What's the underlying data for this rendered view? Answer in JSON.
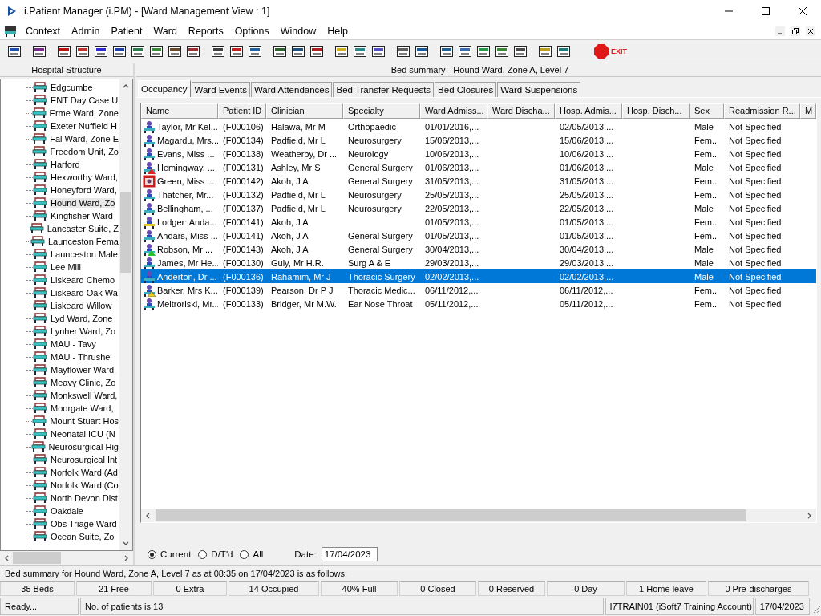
{
  "window": {
    "title": "i.Patient Manager (i.PM) - [Ward Management View : 1]"
  },
  "menu": [
    "Context",
    "Admin",
    "Patient",
    "Ward",
    "Reports",
    "Options",
    "Window",
    "Help"
  ],
  "toolbar": {
    "exit_label": "EXIT"
  },
  "sidebar": {
    "title": "Hospital Structure",
    "items": [
      {
        "label": "Edgcumbe",
        "selected": false
      },
      {
        "label": "ENT Day Case U",
        "selected": false
      },
      {
        "label": "Erme Ward, Zone",
        "selected": false
      },
      {
        "label": "Exeter Nuffield H",
        "selected": false
      },
      {
        "label": "Fal Ward, Zone E",
        "selected": false
      },
      {
        "label": "Freedom Unit, Zo",
        "selected": false
      },
      {
        "label": "Harford",
        "selected": false
      },
      {
        "label": "Hexworthy Ward,",
        "selected": false
      },
      {
        "label": "Honeyford Ward,",
        "selected": false
      },
      {
        "label": "Hound Ward, Zo",
        "selected": true
      },
      {
        "label": "Kingfisher Ward",
        "selected": false
      },
      {
        "label": "Lancaster Suite, Z",
        "selected": false
      },
      {
        "label": "Launceston Fema",
        "selected": false
      },
      {
        "label": "Launceston Male",
        "selected": false
      },
      {
        "label": "Lee Mill",
        "selected": false
      },
      {
        "label": "Liskeard Chemo",
        "selected": false
      },
      {
        "label": "Liskeard Oak Wa",
        "selected": false
      },
      {
        "label": "Liskeard Willow",
        "selected": false
      },
      {
        "label": "Lyd Ward, Zone",
        "selected": false
      },
      {
        "label": "Lynher Ward, Zo",
        "selected": false
      },
      {
        "label": "MAU - Tavy",
        "selected": false
      },
      {
        "label": "MAU - Thrushel",
        "selected": false
      },
      {
        "label": "Mayflower Ward,",
        "selected": false
      },
      {
        "label": "Meavy Clinic, Zo",
        "selected": false
      },
      {
        "label": "Monkswell Ward,",
        "selected": false
      },
      {
        "label": "Moorgate Ward,",
        "selected": false
      },
      {
        "label": "Mount Stuart Hos",
        "selected": false
      },
      {
        "label": "Neonatal ICU (N",
        "selected": false
      },
      {
        "label": "Neurosurgical Hig",
        "selected": false
      },
      {
        "label": "Neurosurgical Int",
        "selected": false
      },
      {
        "label": "Norfolk Ward (Ad",
        "selected": false
      },
      {
        "label": "Norfolk Ward (Co",
        "selected": false
      },
      {
        "label": "North Devon Dist",
        "selected": false
      },
      {
        "label": "Oakdale",
        "selected": false
      },
      {
        "label": "Obs Triage Ward",
        "selected": false
      },
      {
        "label": "Ocean Suite, Zo",
        "selected": false
      }
    ]
  },
  "panel_title": "Bed summary - Hound Ward, Zone A, Level 7",
  "tabs": [
    {
      "label": "Occupancy",
      "selected": true
    },
    {
      "label": "Ward Events",
      "selected": false
    },
    {
      "label": "Ward Attendances",
      "selected": false
    },
    {
      "label": "Bed Transfer Requests",
      "selected": false
    },
    {
      "label": "Bed Closures",
      "selected": false
    },
    {
      "label": "Ward Suspensions",
      "selected": false
    }
  ],
  "table": {
    "columns": [
      "Name",
      "Patient ID",
      "Clinician",
      "Specialty",
      "Ward Admiss...",
      "Ward Discha...",
      "Hosp. Admis...",
      "Hosp. Disch...",
      "Sex",
      "Readmission R...",
      "M"
    ],
    "rows": [
      {
        "kind": "patient",
        "selected": false,
        "name": "Taylor, Mr Kel...",
        "patient_id": "(F000106)",
        "clinician": "Halawa, Mr M",
        "specialty": "Orthopaedic",
        "ward_admission": "01/01/2016,...",
        "hosp_admission": "02/05/2013,...",
        "sex": "Male",
        "readmission": "Not Specified"
      },
      {
        "kind": "patient",
        "selected": false,
        "name": "Magardu, Mrs...",
        "patient_id": "(F000134)",
        "clinician": "Padfield, Mr L",
        "specialty": "Neurosurgery",
        "ward_admission": "15/06/2013,...",
        "hosp_admission": "15/06/2013,...",
        "sex": "Fem...",
        "readmission": "Not Specified"
      },
      {
        "kind": "patient",
        "selected": false,
        "name": "Evans, Miss ...",
        "patient_id": "(F000138)",
        "clinician": "Weatherby, Dr ...",
        "specialty": "Neurology",
        "ward_admission": "10/06/2013,...",
        "hosp_admission": "10/06/2013,...",
        "sex": "Fem...",
        "readmission": "Not Specified"
      },
      {
        "kind": "alert",
        "selected": false,
        "name": "Hemingway, ...",
        "patient_id": "(F000131)",
        "clinician": "Ashley, Mr S",
        "specialty": "General Surgery",
        "ward_admission": "01/06/2013,...",
        "hosp_admission": "01/06/2013,...",
        "sex": "Male",
        "readmission": "Not Specified"
      },
      {
        "kind": "photo",
        "selected": false,
        "name": "Green, Miss ...",
        "patient_id": "(F000142)",
        "clinician": "Akoh, J A",
        "specialty": "General Surgery",
        "ward_admission": "31/05/2013,...",
        "hosp_admission": "31/05/2013,...",
        "sex": "Fem...",
        "readmission": "Not Specified"
      },
      {
        "kind": "patient",
        "selected": false,
        "name": "Thatcher, Mr...",
        "patient_id": "(F000132)",
        "clinician": "Padfield, Mr L",
        "specialty": "Neurosurgery",
        "ward_admission": "25/05/2013,...",
        "hosp_admission": "25/05/2013,...",
        "sex": "Fem...",
        "readmission": "Not Specified"
      },
      {
        "kind": "patient",
        "selected": false,
        "name": "Bellingham, ...",
        "patient_id": "(F000137)",
        "clinician": "Padfield, Mr L",
        "specialty": "Neurosurgery",
        "ward_admission": "22/05/2013,...",
        "hosp_admission": "22/05/2013,...",
        "sex": "Male",
        "readmission": "Not Specified"
      },
      {
        "kind": "lodger",
        "selected": false,
        "name": "Lodger: Anda...",
        "patient_id": "(F000141)",
        "clinician": "Akoh, J A",
        "ward_admission": "01/05/2013,...",
        "hosp_admission": "01/05/2013,...",
        "sex": "Fem...",
        "readmission": "Not Specified"
      },
      {
        "kind": "patient",
        "selected": false,
        "name": "Andars, Miss ...",
        "patient_id": "(F000141)",
        "clinician": "Akoh, J A",
        "specialty": "General Surgery",
        "ward_admission": "01/05/2013,...",
        "hosp_admission": "01/05/2013,...",
        "sex": "Fem...",
        "readmission": "Not Specified"
      },
      {
        "kind": "flag",
        "selected": false,
        "name": "Robson, Mr ...",
        "patient_id": "(F000143)",
        "clinician": "Akoh, J A",
        "specialty": "General Surgery",
        "ward_admission": "30/04/2013,...",
        "hosp_admission": "30/04/2013,...",
        "sex": "Male",
        "readmission": "Not Specified"
      },
      {
        "kind": "patient",
        "selected": false,
        "name": "James, Mr He...",
        "patient_id": "(F000130)",
        "clinician": "Guly, Mr H.R.",
        "specialty": "Surg A & E",
        "ward_admission": "29/03/2013,...",
        "hosp_admission": "29/03/2013,...",
        "sex": "Male",
        "readmission": "Not Specified"
      },
      {
        "kind": "patient",
        "selected": true,
        "name": "Anderton, Dr ...",
        "patient_id": "(F000136)",
        "clinician": "Rahamim, Mr J",
        "specialty": "Thoracic Surgery",
        "ward_admission": "02/02/2013,...",
        "hosp_admission": "02/02/2013,...",
        "sex": "Male",
        "readmission": "Not Specified"
      },
      {
        "kind": "caution",
        "selected": false,
        "name": "Barker, Mrs K...",
        "patient_id": "(F000139)",
        "clinician": "Pearson, Dr P J",
        "specialty": "Thoracic Medic...",
        "ward_admission": "06/11/2012,...",
        "hosp_admission": "06/11/2012,...",
        "sex": "Fem...",
        "readmission": "Not Specified"
      },
      {
        "kind": "patient",
        "selected": false,
        "name": "Meltroriski, Mr...",
        "patient_id": "(F000133)",
        "clinician": "Bridger, Mr M.W.",
        "specialty": "Ear Nose Throat",
        "ward_admission": "05/11/2012,...",
        "hosp_admission": "05/11/2012,...",
        "sex": "Fem...",
        "readmission": "Not Specified"
      }
    ]
  },
  "filter": {
    "options": [
      {
        "label": "Current",
        "selected": true
      },
      {
        "label": "D/T'd",
        "selected": false
      },
      {
        "label": "All",
        "selected": false
      }
    ],
    "date_label": "Date:",
    "date_value": "17/04/2023"
  },
  "summary": "Bed summary for Hound Ward, Zone A, Level 7 as at 08:35 on 17/04/2023 is as follows:",
  "stats": [
    "35 Beds",
    "21 Free",
    "0 Extra",
    "14 Occupied",
    "40% Full",
    "0 Closed",
    "0 Reserved",
    "0 Day",
    "1 Home leave",
    "0 Pre-discharges"
  ],
  "status_bar": [
    "Ready...",
    "No. of patients is 13",
    "I7TRAIN01 (iSoft7 Training Account)",
    "17/04/2023"
  ]
}
